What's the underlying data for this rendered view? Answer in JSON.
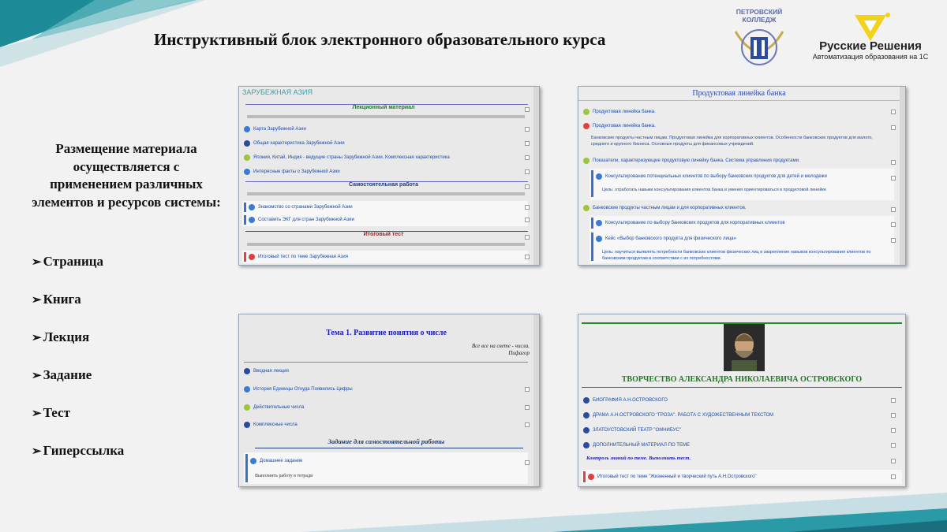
{
  "title": "Инструктивный блок электронного образовательного курса",
  "logos": {
    "college": "ПЕТРОВСКИЙ КОЛЛЕДЖ",
    "rr_name": "Русские Решения",
    "rr_sub": "Автоматизация образования на 1С"
  },
  "intro": "Размещение материала осуществляется с применением различных элементов и ресурсов системы:",
  "bullets": [
    "Страница",
    "Книга",
    "Лекция",
    "Задание",
    "Тест",
    "Гиперссылка"
  ],
  "shot1": {
    "header": "ЗАРУБЕЖНАЯ АЗИЯ",
    "sec1": "Лекционный материал",
    "items": [
      "Карта Зарубежной Азии",
      "Общая характеристика Зарубежной Азии",
      "Япония, Китай, Индия - ведущие страны Зарубежной Азии. Комплексная характеристика",
      "Интересные факты о Зарубежной Азии"
    ],
    "sec2": "Самостоятельная работа",
    "items2": [
      "Знакомство со странами Зарубежной Азии",
      "Составить ЭКГ для стран Зарубежной Азии"
    ],
    "sec3": "Итоговый тест",
    "items3": [
      "Итоговый тест по теме Зарубежная Азия"
    ]
  },
  "shot2": {
    "header": "Продуктовая линейка банка",
    "r1": "Продуктовая линейка банка.",
    "r2": "Продуктовая линейка банка.",
    "r2desc": "Банковские продукты частным лицам. Продуктовая линейка для корпоративных клиентов. Особенности банковских продуктов для малого, среднего и крупного бизнеса. Основные продукты для финансовых учреждений.",
    "r3": "Показатели, характеризующие продуктовую линейку банка. Система управления продуктами.",
    "r4": "Консультирование потенциальных клиентов по выбору банковских продуктов для детей и молодежи",
    "r4desc": "Цель: отработать навыки консультирования клиентов банка и умения ориентироваться в продуктовой линейке",
    "r5": "Банковские продукты частным лицам и для корпоративных клиентов.",
    "r6": "Консультирование по выбору банковских продуктов для корпоративных клиентов",
    "r7": "Кейс «Выбор банковского продукта для физического лица»",
    "r7desc": "Цель: научиться выявлять потребности банковских клиентов физических лиц и закрепление навыков консультирования клиентов по банковским продуктам в соответствии с их потребностями."
  },
  "shot3": {
    "header": "Тема 1. Развитие понятия о числе",
    "quote1": "Все все на свете - числа.",
    "quote2": "Пифагор",
    "items": [
      "Вводная лекция",
      "История Единицы Откуда Появились Цифры",
      "Действительные числа",
      "Комплексные числа"
    ],
    "sec": "Задание для самостоятельной работы",
    "task": "Домашнее задание",
    "task_desc": "Выполнить работу в тетради"
  },
  "shot4": {
    "header": "ТВОРЧЕСТВО АЛЕКСАНДРА НИКОЛАЕВИЧА ОСТРОВСКОГО",
    "items": [
      "БИОГРАФИЯ А.Н.ОСТРОВСКОГО",
      "ДРАМА А.Н.ОСТРОВСКОГО \"ГРОЗА\". РАБОТА С ХУДОЖЕСТВЕННЫМ ТЕКСТОМ",
      "ЗЛАТОУСТОВСКИЙ ТЕАТР \"ОМНИБУС\"",
      "ДОПОЛНИТЕЛЬНЫЙ МАТЕРИАЛ ПО ТЕМЕ"
    ],
    "control": "Контроль знаний по теме. Выполнить тест.",
    "test": "Итоговый тест по теме \"Жизненный и творческий путь А.Н.Островского\""
  },
  "colors": {
    "accent_teal": "#3aa0a8",
    "accent_navy": "#1f3b73",
    "link_blue": "#1a4aa8",
    "green_heading": "#1e7a1e"
  }
}
